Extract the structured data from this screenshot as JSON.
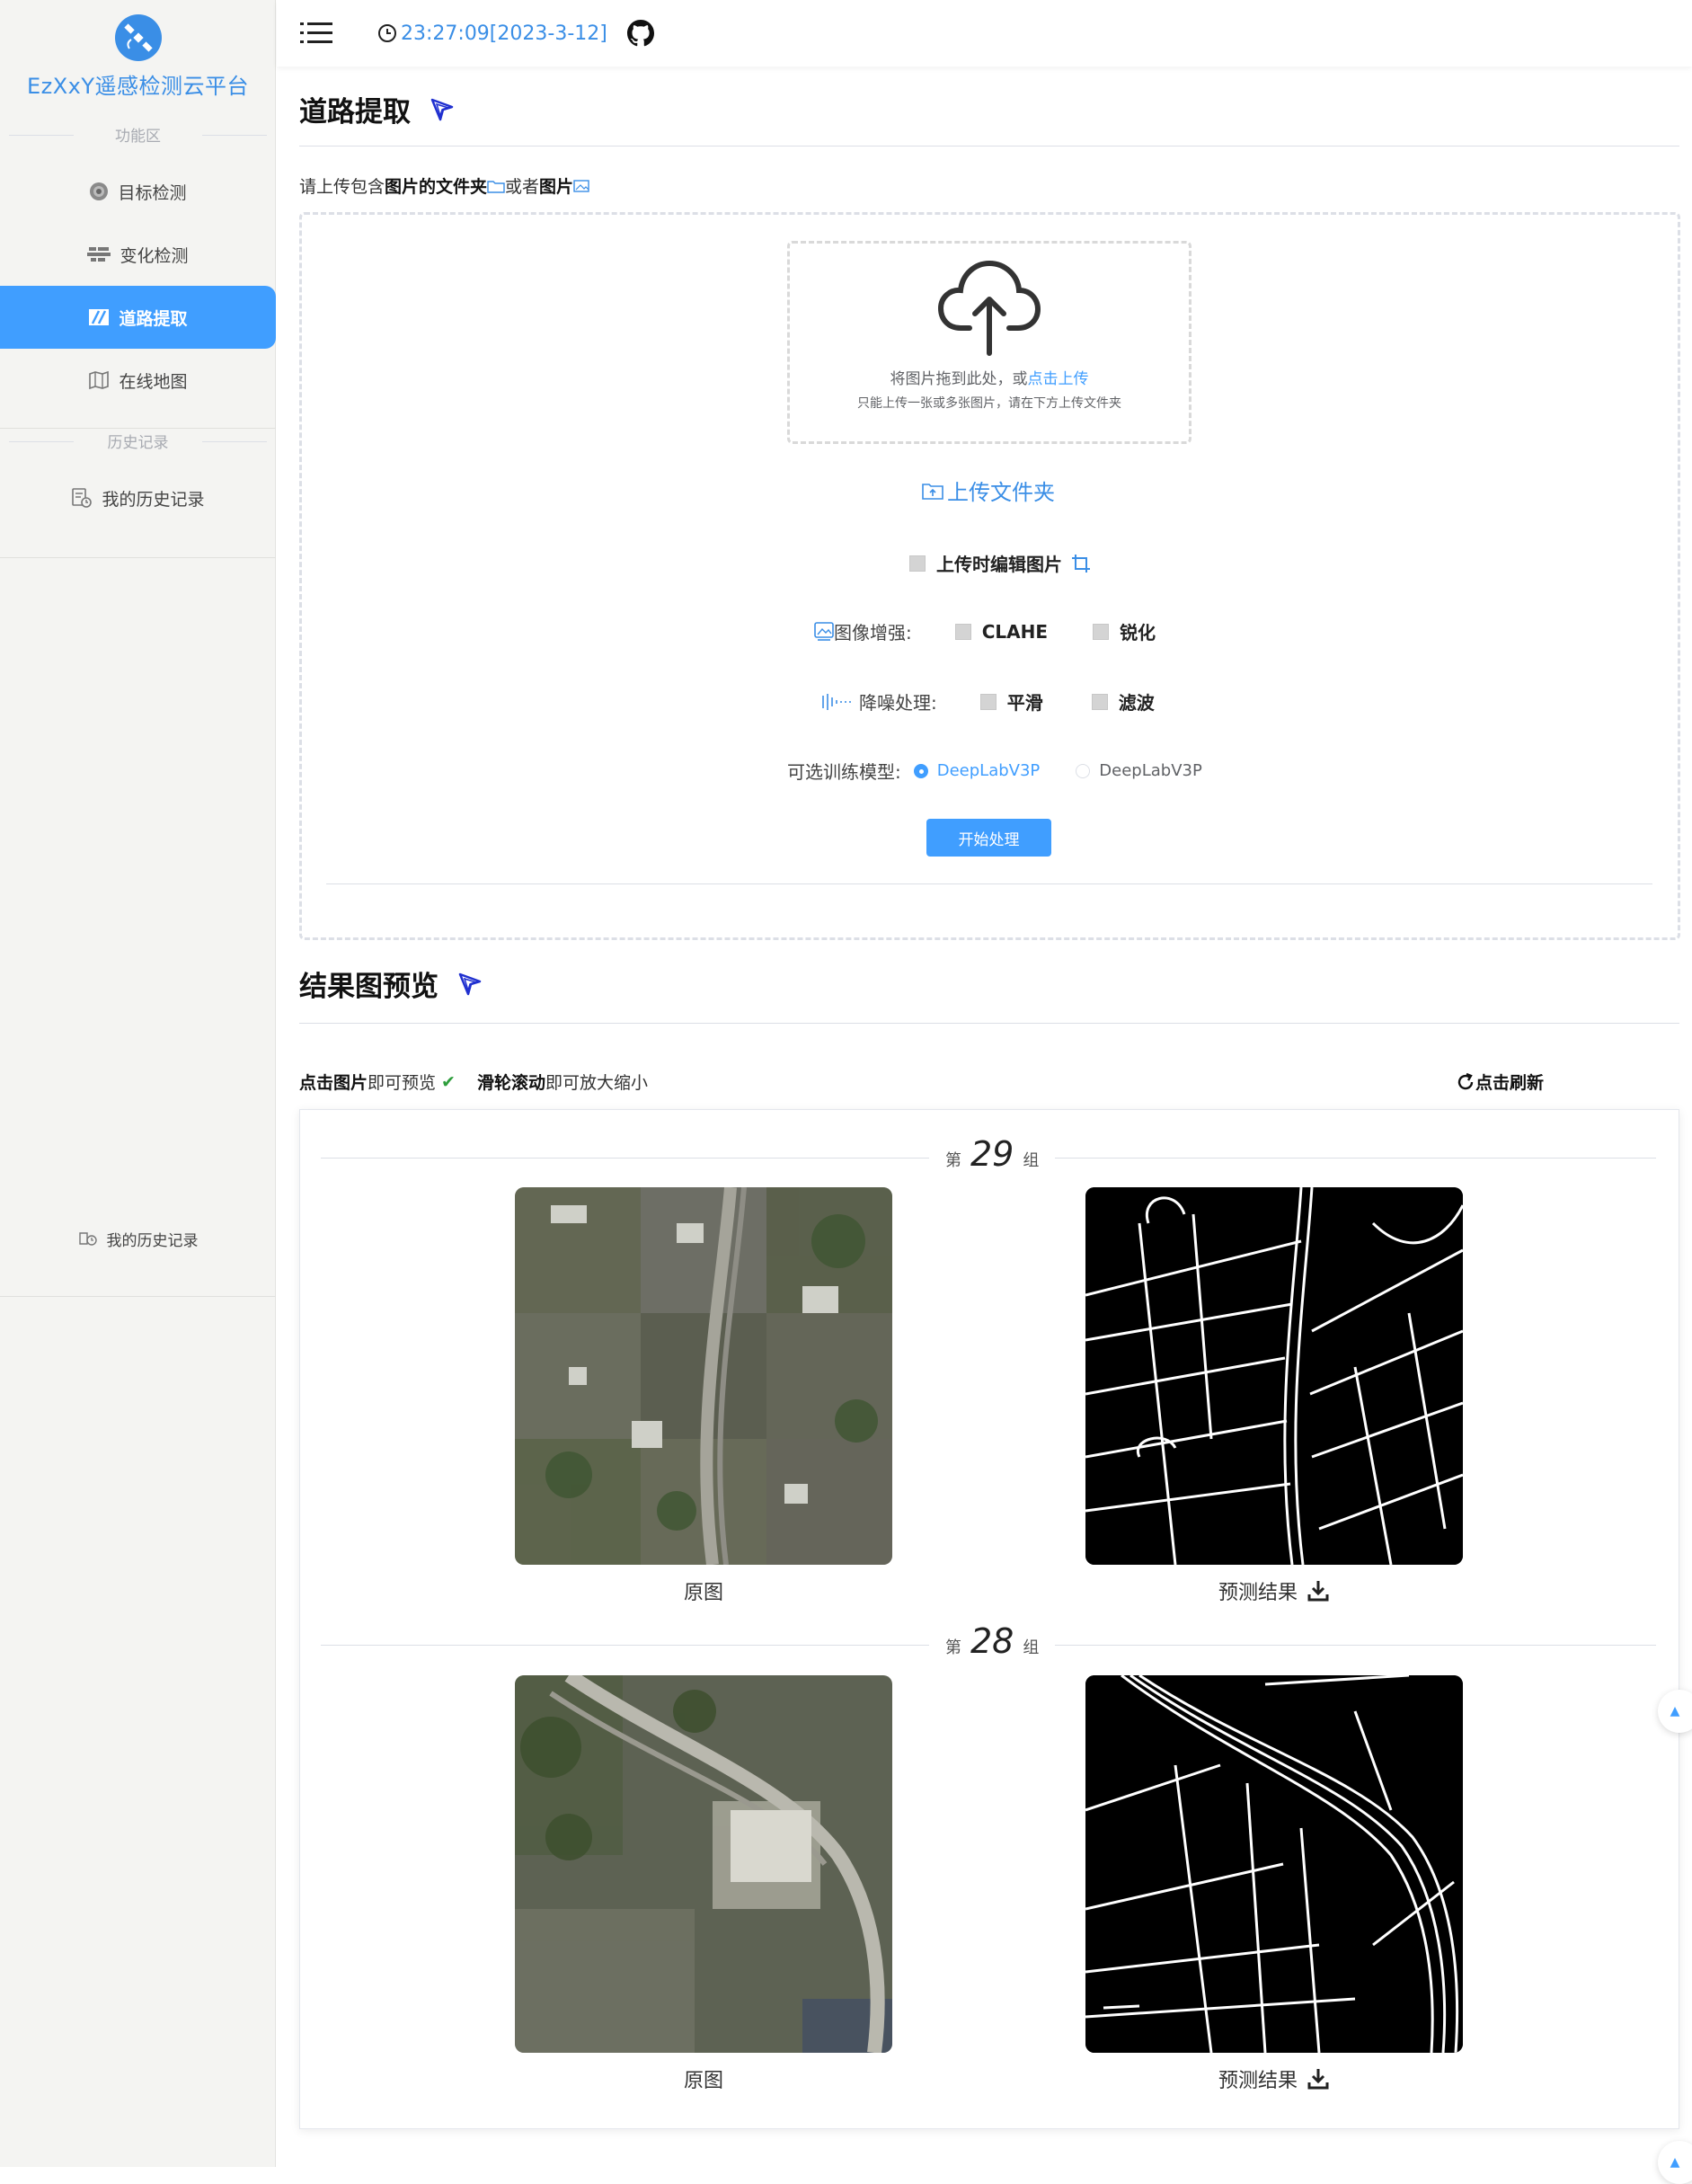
{
  "app": {
    "title": "EzXxY遥感检测云平台"
  },
  "sidebar": {
    "section_function": "功能区",
    "section_history": "历史记录",
    "items": [
      {
        "label": "目标检测",
        "icon": "target-icon"
      },
      {
        "label": "变化检测",
        "icon": "change-icon"
      },
      {
        "label": "道路提取",
        "icon": "road-icon",
        "active": true
      },
      {
        "label": "在线地图",
        "icon": "map-icon"
      }
    ],
    "history_item": "我的历史记录",
    "history_item_collapsed": "我的历史记录"
  },
  "header": {
    "datetime": "23:27:09[2023-3-12]"
  },
  "main": {
    "title": "道路提取",
    "upload_hint": {
      "pre": "请上传包含",
      "folder": "图片的文件夹",
      "or": "或者",
      "image": "图片"
    },
    "dropzone": {
      "text": "将图片拖到此处，或",
      "link": "点击上传",
      "tip": "只能上传一张或多张图片，请在下方上传文件夹"
    },
    "upload_folder": "上传文件夹",
    "edit_on_upload": "上传时编辑图片",
    "enhance": {
      "label": "图像增强:",
      "options": [
        "CLAHE",
        "锐化"
      ]
    },
    "denoise": {
      "label": "降噪处理:",
      "options": [
        "平滑",
        "滤波"
      ]
    },
    "model": {
      "label": "可选训练模型:",
      "options": [
        "DeepLabV3P",
        "DeepLabV3P"
      ],
      "selected": 0
    },
    "start_button": "开始处理"
  },
  "results": {
    "title": "结果图预览",
    "tip_click": "点击图片",
    "tip_click_rest": "即可预览",
    "tip_wheel": "滑轮滚动",
    "tip_wheel_rest": "即可放大缩小",
    "refresh": "点击刷新",
    "groups": [
      {
        "prefix": "第",
        "number": "29",
        "suffix": "组",
        "original_label": "原图",
        "result_label": "预测结果"
      },
      {
        "prefix": "第",
        "number": "28",
        "suffix": "组",
        "original_label": "原图",
        "result_label": "预测结果"
      }
    ]
  },
  "colors": {
    "accent": "#409eff",
    "brand_text": "#3a8ee6"
  }
}
